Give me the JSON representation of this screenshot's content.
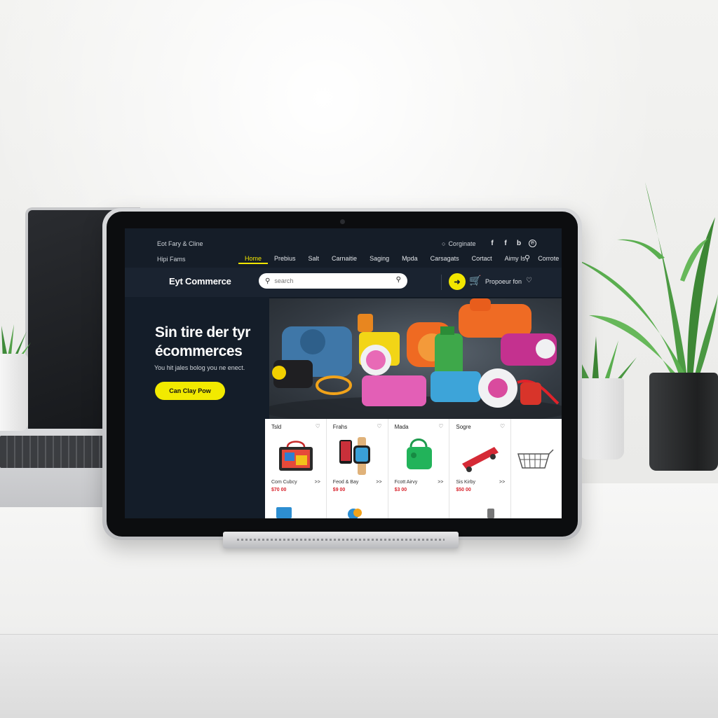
{
  "topbar": {
    "promo": "Eot Fary & Cline",
    "help": "Hipi Fams",
    "account_label": "Corginate",
    "socials": [
      "f",
      "f",
      "b",
      "℗"
    ]
  },
  "nav": {
    "items": [
      {
        "label": "Home",
        "active": true
      },
      {
        "label": "Prebius",
        "active": false
      },
      {
        "label": "Salt",
        "active": false
      },
      {
        "label": "Carnaitie",
        "active": false
      },
      {
        "label": "Saging",
        "active": false
      },
      {
        "label": "Mpda",
        "active": false
      },
      {
        "label": "Carsagats",
        "active": false
      },
      {
        "label": "Cortact",
        "active": false
      },
      {
        "label": "Aimy Is",
        "active": false
      },
      {
        "label": "Corrote",
        "active": false
      }
    ]
  },
  "header": {
    "brand": "Eyt Commerce",
    "search_placeholder": "search",
    "cart_label": "Propoeur fon"
  },
  "hero": {
    "title_line1": "Sin tire der tyr",
    "title_line2": "écommerces",
    "subtitle": "You hit jales bolog you ne enect.",
    "cta_label": "Can Clay Pow"
  },
  "products": [
    {
      "category": "Tsld",
      "name": "Com Cubcy",
      "price": "$70 00",
      "more": ">>"
    },
    {
      "category": "Frahs",
      "name": "Feod & Bay",
      "price": "$9 00",
      "more": ">>"
    },
    {
      "category": "Mada",
      "name": "Fcott Airvy",
      "price": "$3 00",
      "more": ">>"
    },
    {
      "category": "Sogre",
      "name": "Sis Kirby",
      "price": "$50 00",
      "more": ">>"
    }
  ],
  "colors": {
    "accent": "#f2e600",
    "page_bg": "#121a24",
    "price": "#d8222b"
  }
}
